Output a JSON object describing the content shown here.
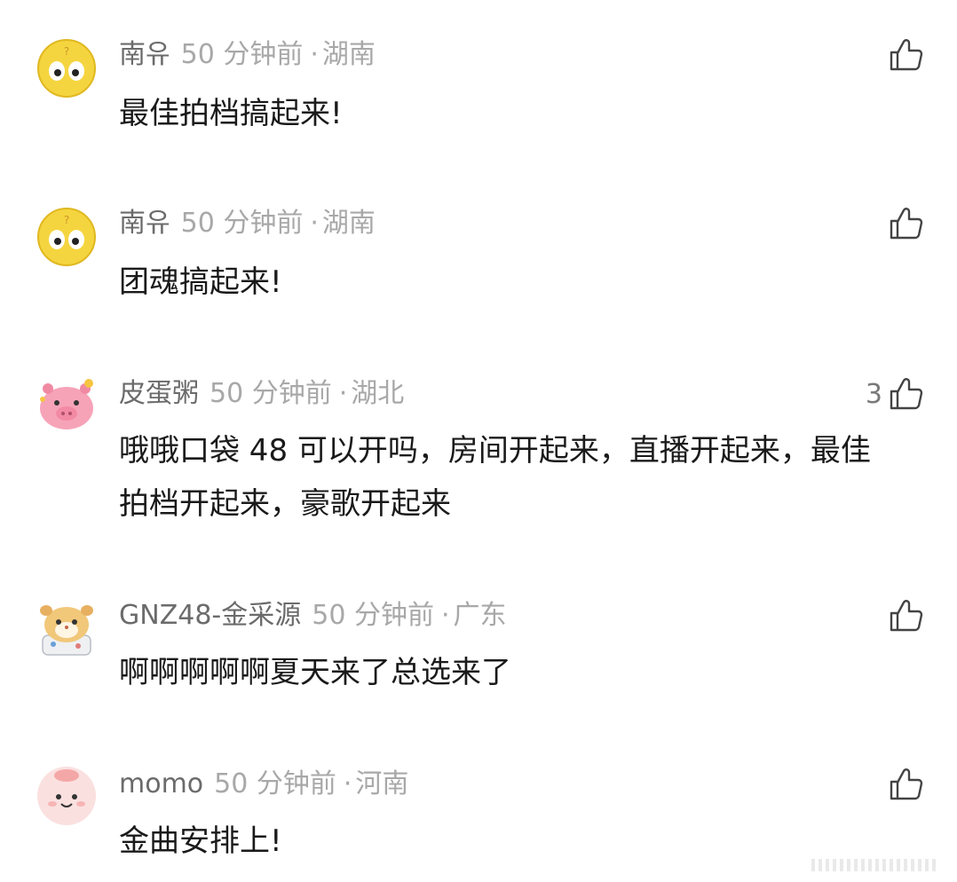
{
  "comments": [
    {
      "username": "南유",
      "time": "50 分钟前",
      "location": "湖南",
      "text": "最佳拍档搞起来!",
      "likes": "",
      "avatar_icon": "confused-yellow-face-avatar"
    },
    {
      "username": "南유",
      "time": "50 分钟前",
      "location": "湖南",
      "text": "团魂搞起来!",
      "likes": "",
      "avatar_icon": "confused-yellow-face-avatar"
    },
    {
      "username": "皮蛋粥",
      "time": "50 分钟前",
      "location": "湖北",
      "text": "哦哦口袋 48 可以开吗，房间开起来，直播开起来，最佳拍档开起来，豪歌开起来",
      "likes": "3",
      "avatar_icon": "pink-pig-avatar"
    },
    {
      "username": "GNZ48-金采源",
      "time": "50 分钟前",
      "location": "广东",
      "text": "啊啊啊啊啊夏天来了总选来了",
      "likes": "",
      "avatar_icon": "cartoon-hamster-avatar"
    },
    {
      "username": "momo",
      "time": "50 分钟前",
      "location": "河南",
      "text": "金曲安排上!",
      "likes": "",
      "avatar_icon": "pink-bunny-avatar"
    }
  ],
  "like_icon": "thumbs-up-outline-icon",
  "separator": "·"
}
